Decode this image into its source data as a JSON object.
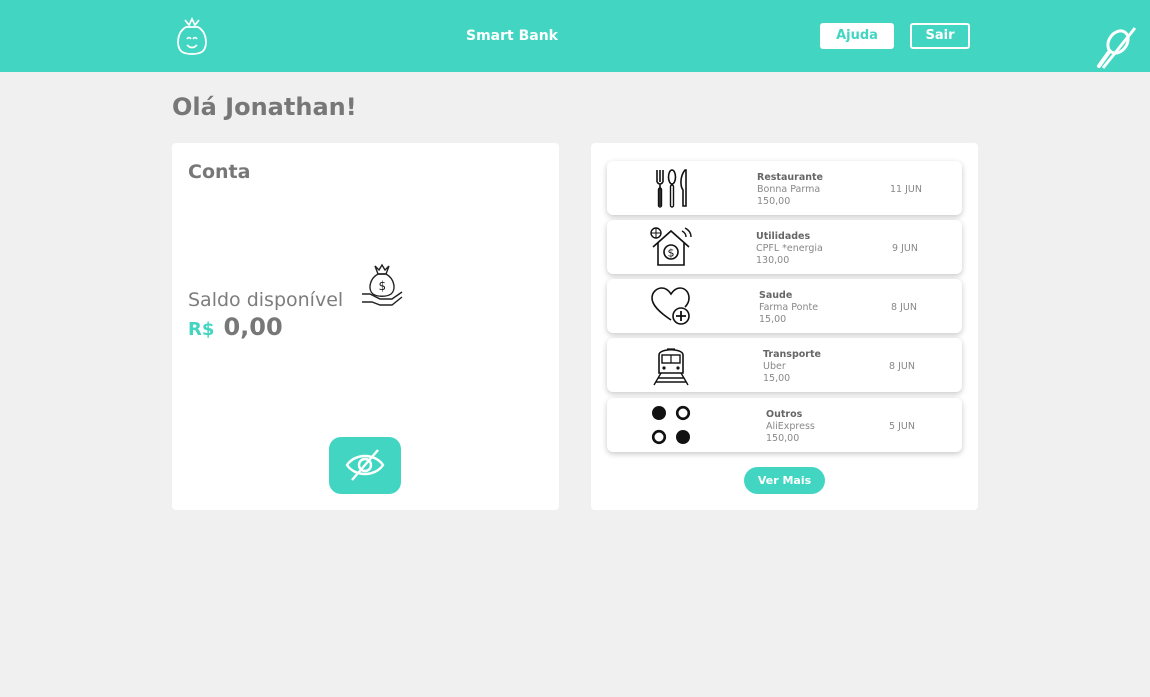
{
  "header": {
    "brand": "Smart Bank",
    "help_label": "Ajuda",
    "exit_label": "Sair",
    "logo_icon": "money-bag-face-icon",
    "mute_icon": "microphone-off-icon"
  },
  "greeting": "Olá Jonathan!",
  "account": {
    "title": "Conta",
    "balance_label": "Saldo disponível",
    "currency": "R$",
    "balance": "0,00",
    "bag_icon": "money-bag-hand-icon",
    "toggle_icon": "eye-off-icon"
  },
  "transactions": [
    {
      "category": "Restaurante",
      "merchant": "Bonna Parma",
      "amount": "150,00",
      "date": "11 JUN",
      "icon": "cutlery-icon"
    },
    {
      "category": "Utilidades",
      "merchant": "CPFL *energia",
      "amount": "130,00",
      "date": "9 JUN",
      "icon": "smart-home-icon"
    },
    {
      "category": "Saude",
      "merchant": "Farma Ponte",
      "amount": "15,00",
      "date": "8 JUN",
      "icon": "heart-plus-icon"
    },
    {
      "category": "Transporte",
      "merchant": "Uber",
      "amount": "15,00",
      "date": "8 JUN",
      "icon": "train-icon"
    },
    {
      "category": "Outros",
      "merchant": "AliExpress",
      "amount": "150,00",
      "date": "5 JUN",
      "icon": "dots-icon"
    }
  ],
  "more_label": "Ver Mais",
  "colors": {
    "accent": "#42d6c2",
    "background": "#f0f0f0",
    "text": "#777777"
  }
}
